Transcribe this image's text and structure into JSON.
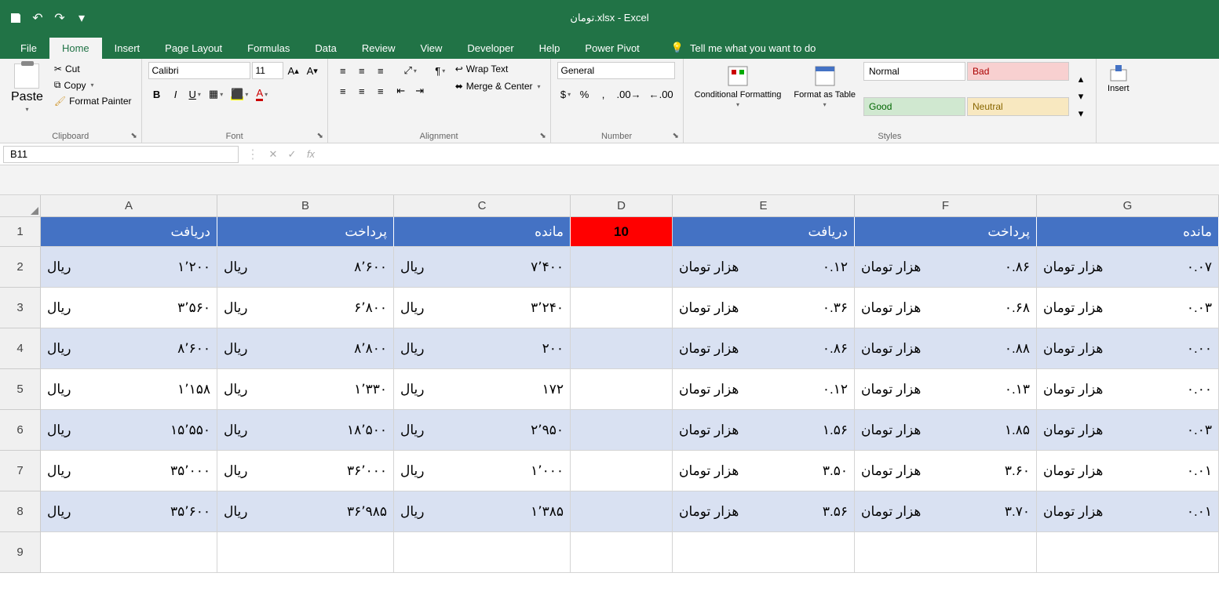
{
  "app": {
    "title": "تومان.xlsx - Excel"
  },
  "tabs": [
    "File",
    "Home",
    "Insert",
    "Page Layout",
    "Formulas",
    "Data",
    "Review",
    "View",
    "Developer",
    "Help",
    "Power Pivot"
  ],
  "tellme": "Tell me what you want to do",
  "clipboard": {
    "cut": "Cut",
    "copy": "Copy",
    "painter": "Format Painter",
    "paste": "Paste",
    "label": "Clipboard"
  },
  "font": {
    "name": "Calibri",
    "size": "11",
    "label": "Font"
  },
  "alignment": {
    "wrap": "Wrap Text",
    "merge": "Merge & Center",
    "label": "Alignment"
  },
  "number": {
    "format": "General",
    "label": "Number"
  },
  "cond": "Conditional Formatting",
  "formatTable": "Format as Table",
  "styles": {
    "normal": "Normal",
    "bad": "Bad",
    "good": "Good",
    "neutral": "Neutral",
    "label": "Styles"
  },
  "insert": "Insert",
  "namebox": "B11",
  "columns": [
    "A",
    "B",
    "C",
    "D",
    "E",
    "F",
    "G"
  ],
  "rowNums": [
    "1",
    "2",
    "3",
    "4",
    "5",
    "6",
    "7",
    "8",
    "9"
  ],
  "headers": {
    "A": "دریافت",
    "B": "پرداخت",
    "C": "مانده",
    "D": "10",
    "E": "دریافت",
    "F": "پرداخت",
    "G": "مانده"
  },
  "rows": [
    {
      "band": true,
      "A": {
        "u": "ریال",
        "v": "۱٬۲۰۰"
      },
      "B": {
        "u": "ریال",
        "v": "۸٬۶۰۰"
      },
      "C": {
        "u": "ریال",
        "v": "۷٬۴۰۰"
      },
      "E": {
        "u": "هزار تومان",
        "v": "۰.۱۲"
      },
      "F": {
        "u": "هزار تومان",
        "v": "۰.۸۶"
      },
      "G": {
        "u": "هزار تومان",
        "v": "۰.۰۷"
      }
    },
    {
      "band": false,
      "A": {
        "u": "ریال",
        "v": "۳٬۵۶۰"
      },
      "B": {
        "u": "ریال",
        "v": "۶٬۸۰۰"
      },
      "C": {
        "u": "ریال",
        "v": "۳٬۲۴۰"
      },
      "E": {
        "u": "هزار تومان",
        "v": "۰.۳۶"
      },
      "F": {
        "u": "هزار تومان",
        "v": "۰.۶۸"
      },
      "G": {
        "u": "هزار تومان",
        "v": "۰.۰۳"
      }
    },
    {
      "band": true,
      "A": {
        "u": "ریال",
        "v": "۸٬۶۰۰"
      },
      "B": {
        "u": "ریال",
        "v": "۸٬۸۰۰"
      },
      "C": {
        "u": "ریال",
        "v": "۲۰۰"
      },
      "E": {
        "u": "هزار تومان",
        "v": "۰.۸۶"
      },
      "F": {
        "u": "هزار تومان",
        "v": "۰.۸۸"
      },
      "G": {
        "u": "هزار تومان",
        "v": "۰.۰۰"
      }
    },
    {
      "band": false,
      "A": {
        "u": "ریال",
        "v": "۱٬۱۵۸"
      },
      "B": {
        "u": "ریال",
        "v": "۱٬۳۳۰"
      },
      "C": {
        "u": "ریال",
        "v": "۱۷۲"
      },
      "E": {
        "u": "هزار تومان",
        "v": "۰.۱۲"
      },
      "F": {
        "u": "هزار تومان",
        "v": "۰.۱۳"
      },
      "G": {
        "u": "هزار تومان",
        "v": "۰.۰۰"
      }
    },
    {
      "band": true,
      "A": {
        "u": "ریال",
        "v": "۱۵٬۵۵۰"
      },
      "B": {
        "u": "ریال",
        "v": "۱۸٬۵۰۰"
      },
      "C": {
        "u": "ریال",
        "v": "۲٬۹۵۰"
      },
      "E": {
        "u": "هزار تومان",
        "v": "۱.۵۶"
      },
      "F": {
        "u": "هزار تومان",
        "v": "۱.۸۵"
      },
      "G": {
        "u": "هزار تومان",
        "v": "۰.۰۳"
      }
    },
    {
      "band": false,
      "A": {
        "u": "ریال",
        "v": "۳۵٬۰۰۰"
      },
      "B": {
        "u": "ریال",
        "v": "۳۶٬۰۰۰"
      },
      "C": {
        "u": "ریال",
        "v": "۱٬۰۰۰"
      },
      "E": {
        "u": "هزار تومان",
        "v": "۳.۵۰"
      },
      "F": {
        "u": "هزار تومان",
        "v": "۳.۶۰"
      },
      "G": {
        "u": "هزار تومان",
        "v": "۰.۰۱"
      }
    },
    {
      "band": true,
      "A": {
        "u": "ریال",
        "v": "۳۵٬۶۰۰"
      },
      "B": {
        "u": "ریال",
        "v": "۳۶٬۹۸۵"
      },
      "C": {
        "u": "ریال",
        "v": "۱٬۳۸۵"
      },
      "E": {
        "u": "هزار تومان",
        "v": "۳.۵۶"
      },
      "F": {
        "u": "هزار تومان",
        "v": "۳.۷۰"
      },
      "G": {
        "u": "هزار تومان",
        "v": "۰.۰۱"
      }
    }
  ]
}
